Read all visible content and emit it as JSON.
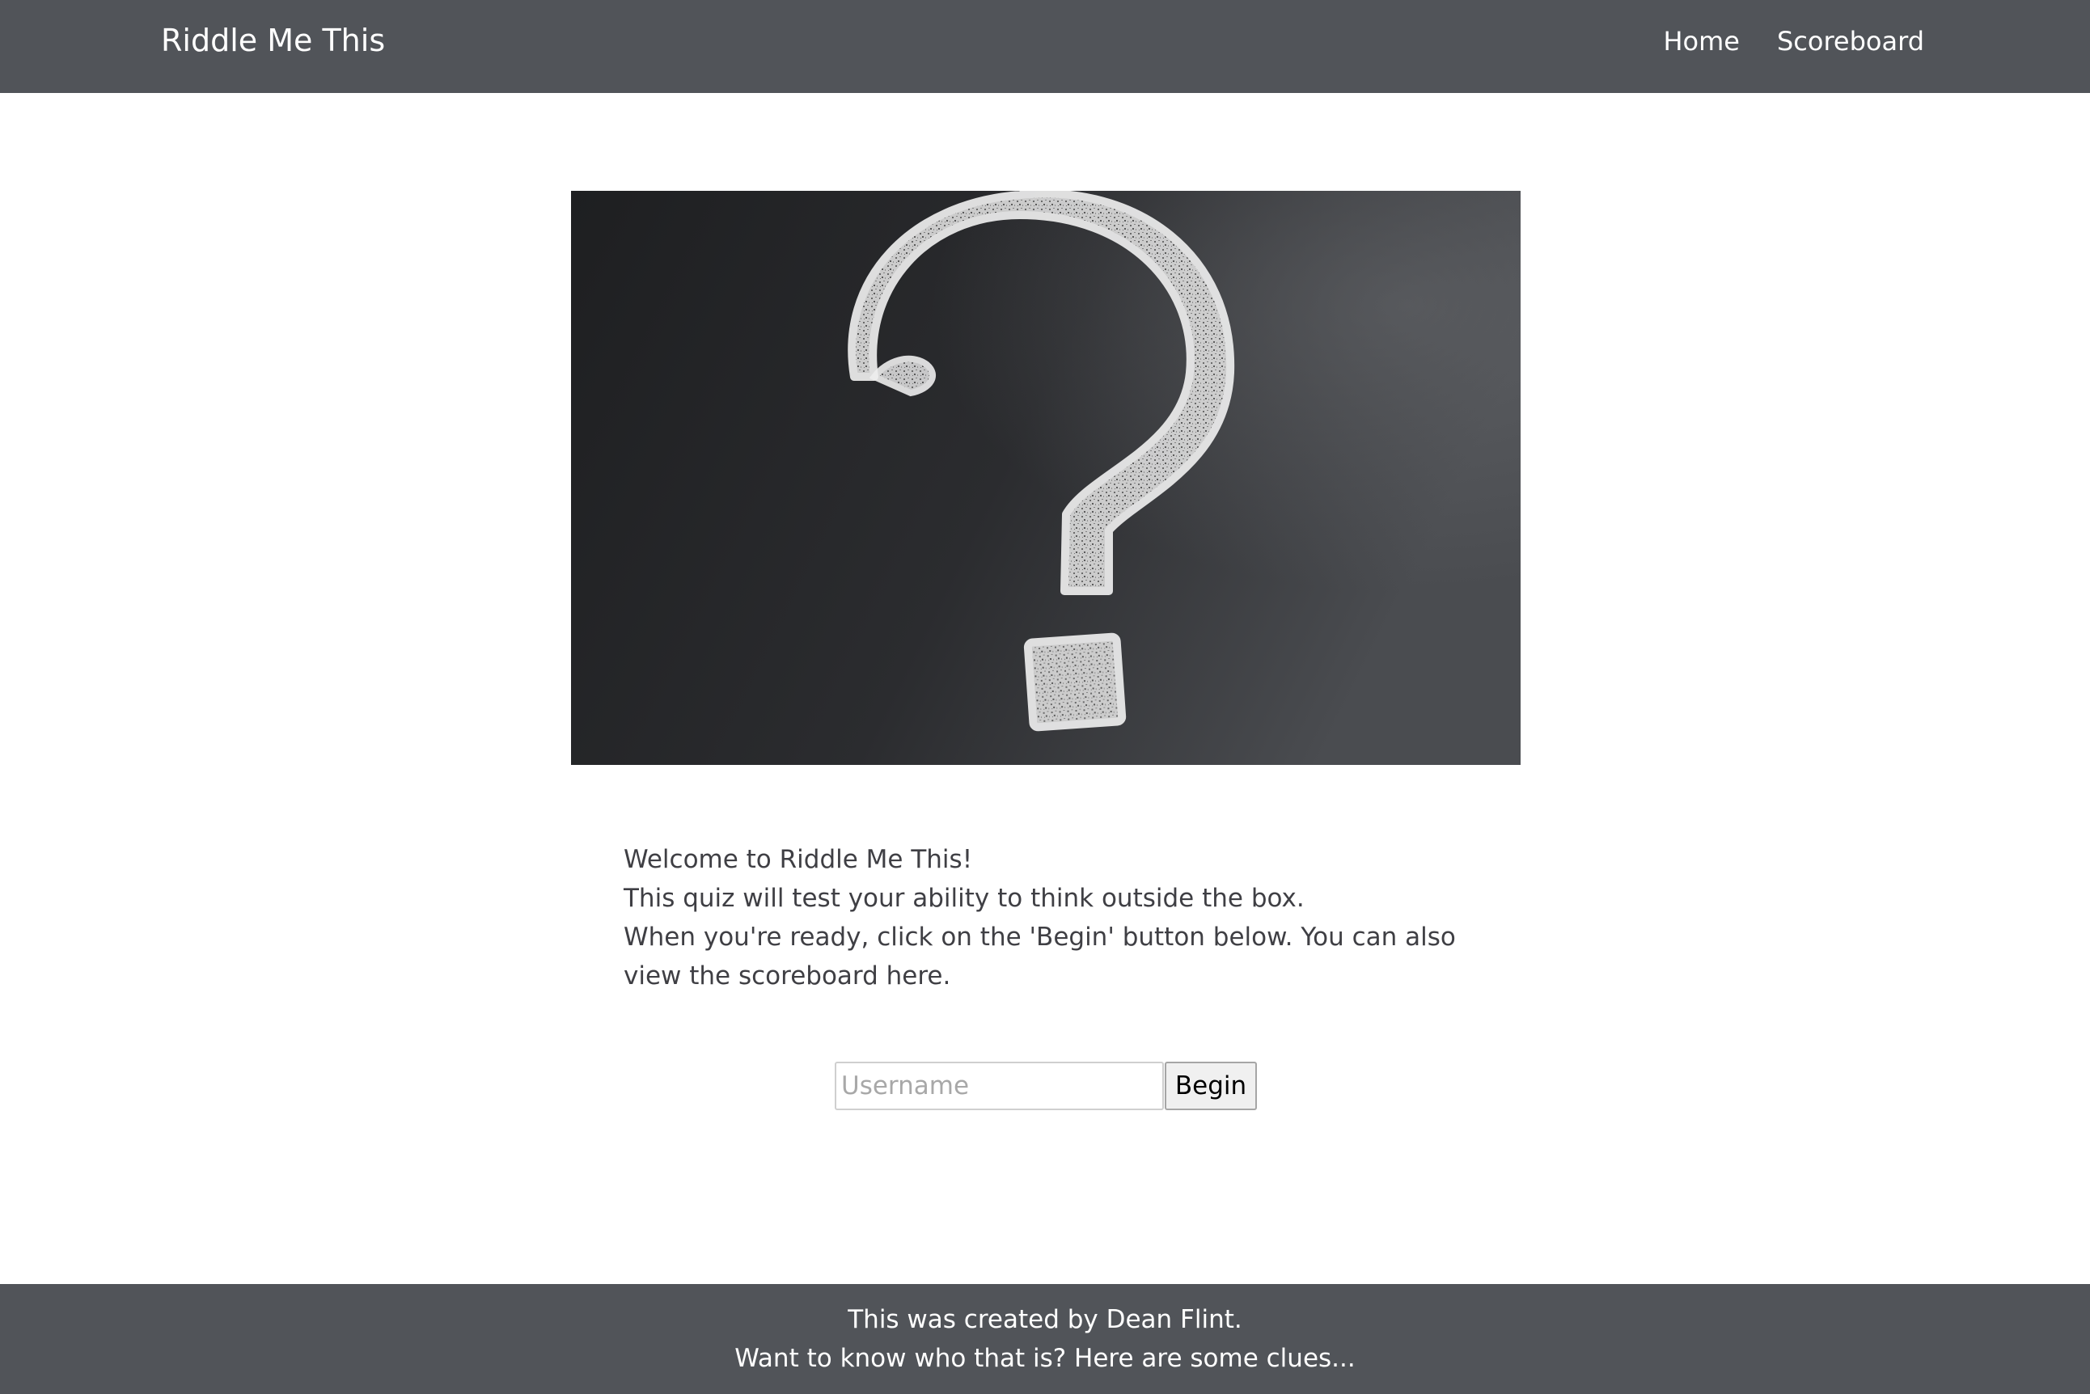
{
  "navbar": {
    "brand": "Riddle Me This",
    "links": [
      {
        "label": "Home"
      },
      {
        "label": "Scoreboard"
      }
    ]
  },
  "hero": {
    "icon": "chalk-question-mark"
  },
  "intro": {
    "lines": [
      "Welcome to Riddle Me This!",
      "This quiz will test your ability to think outside the box.",
      "When you're ready, click on the 'Begin' button below. You can also view the scoreboard here."
    ]
  },
  "form": {
    "username_placeholder": "Username",
    "username_value": "",
    "begin_label": "Begin"
  },
  "footer": {
    "lines": [
      "This was created by Dean Flint.",
      "Want to know who that is? Here are some clues..."
    ]
  },
  "colors": {
    "navbar_bg": "#515459",
    "footer_bg": "#515459",
    "body_text": "#3f3f44",
    "chalkboard": "#2a2b2d"
  }
}
